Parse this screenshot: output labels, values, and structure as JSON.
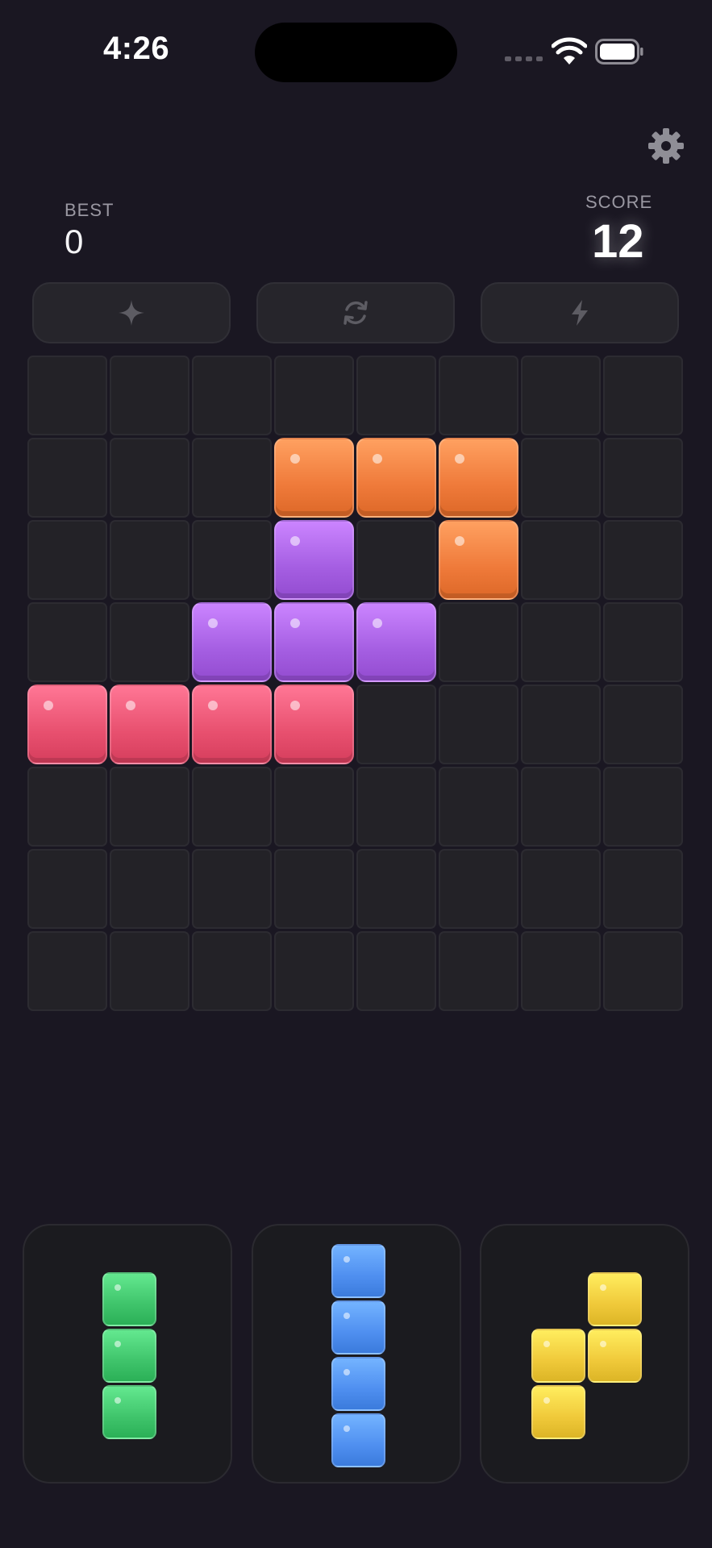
{
  "status_bar": {
    "time": "4:26",
    "icons": [
      "cellular-signal-icon",
      "wifi-icon",
      "battery-icon"
    ]
  },
  "header": {
    "settings_icon": "gear-icon",
    "best_label": "BEST",
    "best_value": "0",
    "score_label": "SCORE",
    "score_value": "12"
  },
  "powerups": [
    {
      "icon": "sparkle-icon"
    },
    {
      "icon": "refresh-icon"
    },
    {
      "icon": "lightning-icon"
    }
  ],
  "colors": {
    "orange": "#ef7a3a",
    "purple": "#a55ee2",
    "pink": "#e8506f",
    "green": "#3fc46b",
    "blue": "#4f8ff0",
    "yellow": "#f0c93a",
    "empty": "#232227"
  },
  "board": {
    "rows": 8,
    "cols": 8,
    "cells": [
      [
        "",
        "",
        "",
        "",
        "",
        "",
        "",
        ""
      ],
      [
        "",
        "",
        "",
        "orange",
        "orange",
        "orange",
        "",
        ""
      ],
      [
        "",
        "",
        "",
        "purple",
        "",
        "orange",
        "",
        ""
      ],
      [
        "",
        "",
        "purple",
        "purple",
        "purple",
        "",
        "",
        ""
      ],
      [
        "pink",
        "pink",
        "pink",
        "pink",
        "",
        "",
        "",
        ""
      ],
      [
        "",
        "",
        "",
        "",
        "",
        "",
        "",
        ""
      ],
      [
        "",
        "",
        "",
        "",
        "",
        "",
        "",
        ""
      ],
      [
        "",
        "",
        "",
        "",
        "",
        "",
        "",
        ""
      ]
    ]
  },
  "tray_pieces": [
    {
      "color": "green",
      "shape": [
        [
          1
        ],
        [
          1
        ],
        [
          1
        ]
      ]
    },
    {
      "color": "blue",
      "shape": [
        [
          1
        ],
        [
          1
        ],
        [
          1
        ],
        [
          1
        ]
      ]
    },
    {
      "color": "yellow",
      "shape": [
        [
          0,
          1
        ],
        [
          1,
          1
        ],
        [
          1,
          0
        ]
      ]
    }
  ]
}
